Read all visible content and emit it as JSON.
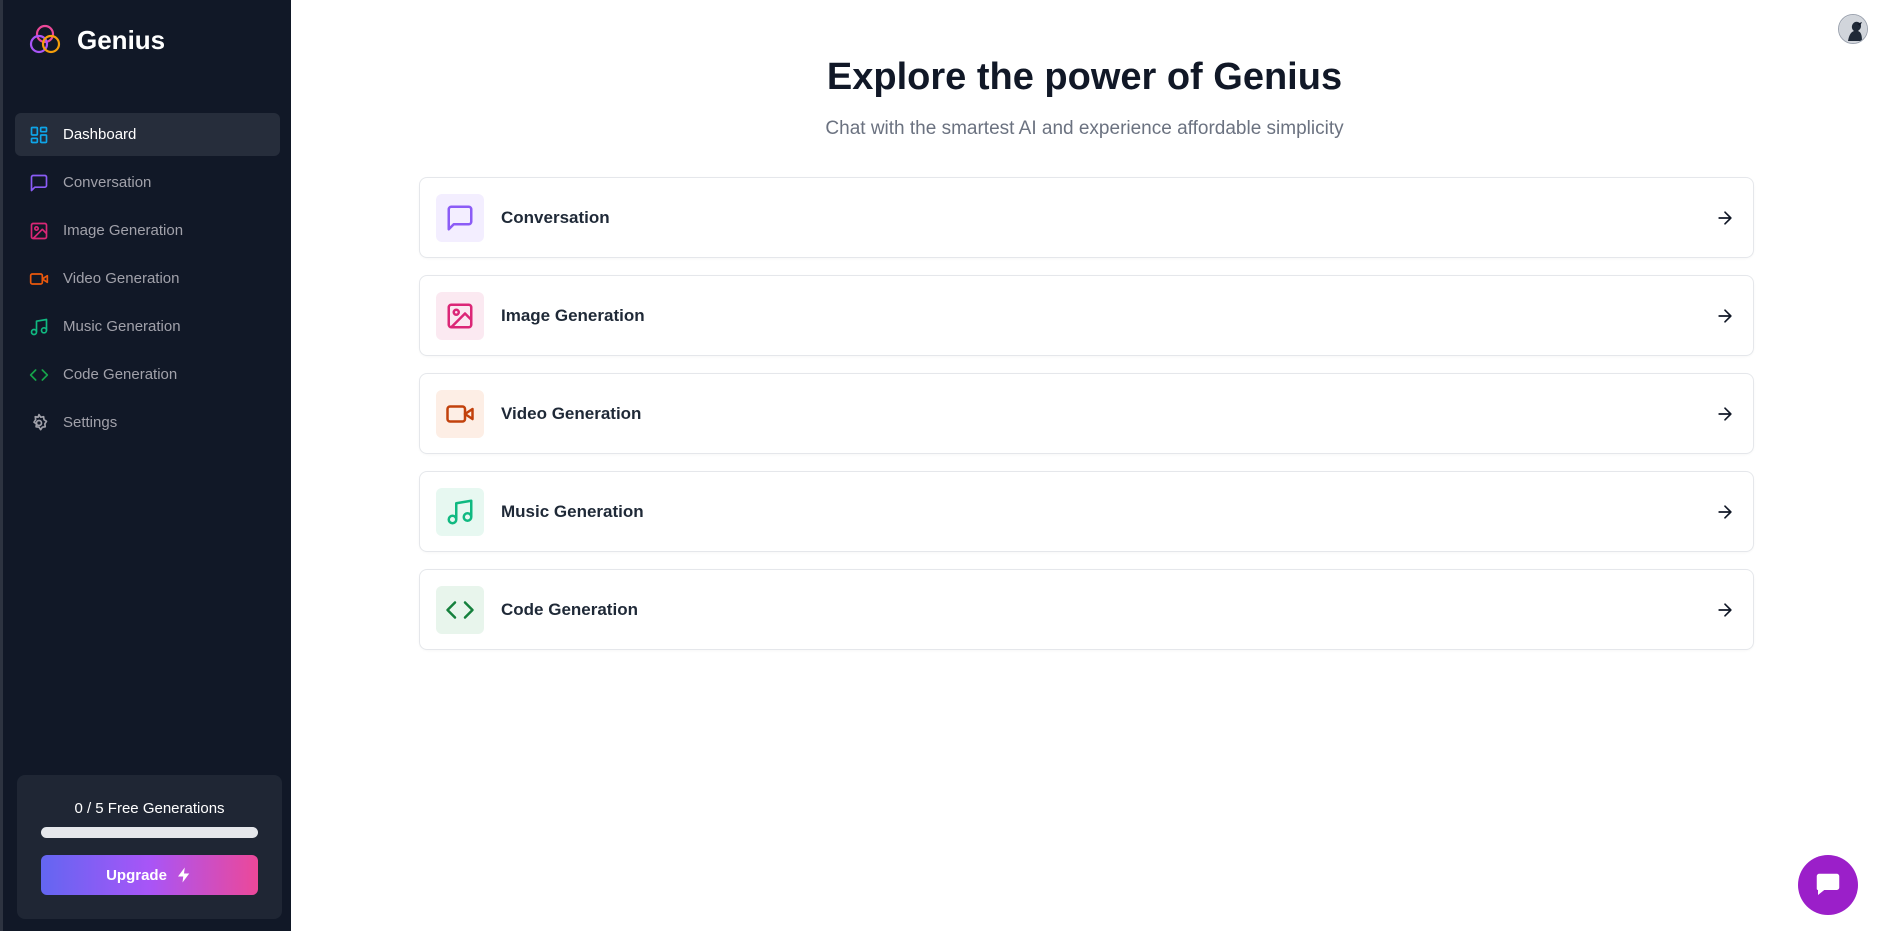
{
  "app": {
    "name": "Genius"
  },
  "sidebar": {
    "items": [
      {
        "label": "Dashboard",
        "icon": "dashboard-icon",
        "color": "#0ea5e9",
        "active": true
      },
      {
        "label": "Conversation",
        "icon": "message-square-icon",
        "color": "#8b5cf6"
      },
      {
        "label": "Image Generation",
        "icon": "image-icon",
        "color": "#db2777"
      },
      {
        "label": "Video Generation",
        "icon": "video-icon",
        "color": "#ea580c"
      },
      {
        "label": "Music Generation",
        "icon": "music-icon",
        "color": "#10b981"
      },
      {
        "label": "Code Generation",
        "icon": "code-icon",
        "color": "#16a34a"
      },
      {
        "label": "Settings",
        "icon": "settings-icon",
        "color": "#a1a1aa"
      }
    ],
    "usage": {
      "text": "0 / 5 Free Generations",
      "used": 0,
      "limit": 5,
      "upgrade_label": "Upgrade"
    }
  },
  "main": {
    "heading": "Explore the power of Genius",
    "subheading": "Chat with the smartest AI and experience affordable simplicity",
    "tools": [
      {
        "label": "Conversation",
        "icon": "message-square-icon",
        "color": "#8b5cf6",
        "bg": "#f3eeff"
      },
      {
        "label": "Image Generation",
        "icon": "image-icon",
        "color": "#db2777",
        "bg": "#fbe9f1"
      },
      {
        "label": "Video Generation",
        "icon": "video-icon",
        "color": "#c2410c",
        "bg": "#fdeee5"
      },
      {
        "label": "Music Generation",
        "icon": "music-icon",
        "color": "#10b981",
        "bg": "#e7f8f1"
      },
      {
        "label": "Code Generation",
        "icon": "code-icon",
        "color": "#15803d",
        "bg": "#e8f5ec"
      }
    ]
  },
  "header": {
    "avatar": "user-avatar"
  },
  "chat_widget": {
    "icon": "chat-bubble-icon",
    "color": "#9b1fc9"
  }
}
